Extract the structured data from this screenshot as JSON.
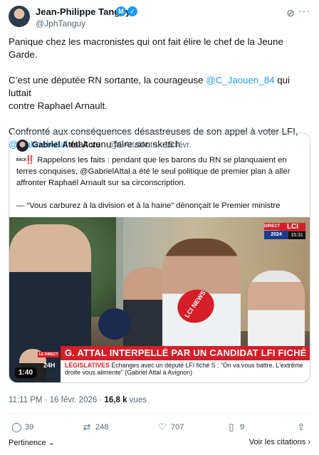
{
  "author": {
    "name": "Jean-Philippe Tanguy",
    "handle": "@JphTanguy",
    "badge_letter": "M",
    "verified_icon": "verified-check-icon"
  },
  "header_icons": [
    "grok-icon",
    "more-icon"
  ],
  "post": {
    "para1": "Panique chez les macronistes qui ont fait élire le chef de la Jeune Garde.",
    "para2_pre": "C’est une députée RN sortante, la courageuse ",
    "para2_mention": "@C_Jaouen_84",
    "para2_mid": " qui luttait",
    "para2_post": "contre Raphael Arnault.",
    "para3_pre": "Confronté aux conséquences désastreuses de son appel à voter LFI,",
    "para3_mention": "@GabrielAttal",
    "para3_post": " était venu faire son sketch."
  },
  "quote": {
    "name": "Gabriel Attal Actu",
    "handle": "@GAttalActu",
    "date": "15 févr.",
    "back_emoji": "BACK",
    "alert_emoji": "‼️",
    "text1": " Rappelons les faits : pendant que les barons du RN se planquaient en terres conquises, @GabrielAttal a été le seul politique de premier plan à aller affronter Raphaël Arnault sur sa circonscription.",
    "text2": "— “Vous carburez à la division et à la haine” dénonçait le Premier ministre"
  },
  "video": {
    "channel_direct": "DIRECT",
    "channel_name": "LCI",
    "channel_year": "2024",
    "channel_time": "15:31",
    "mic_label": "LCI NEWS",
    "thumb_direct": "LE DIRECT",
    "thumb_24h": "24H",
    "headline": "G. ATTAL INTERPELLÉ PAR UN CANDIDAT LFI FICHÉ S",
    "sub_label": "LÉGISLATIVES",
    "sub_text": " Echanges avec un député LFI fiché S : \"On va vous battre. L'extrême droite vous alimente\" (Gabriel Attal à Avignon)",
    "duration": "1:40"
  },
  "meta": {
    "time": "11:11 PM",
    "date": "16 févr. 2026",
    "views_count": "16,8 k",
    "views_label": " vues"
  },
  "actions": {
    "reply": "39",
    "retweet": "248",
    "like": "707",
    "bookmark": "9"
  },
  "footer": {
    "left": "Pertinence",
    "right": "Voir les citations"
  }
}
